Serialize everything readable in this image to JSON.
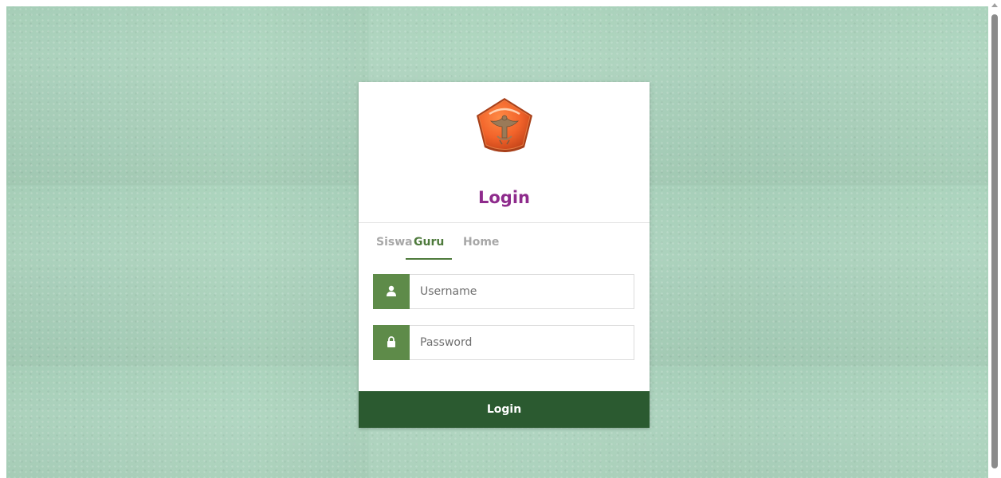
{
  "page": {
    "background_color": "#a9d2bb"
  },
  "login_card": {
    "logo_icon": "school-emblem-logo",
    "title": "Login",
    "title_color": "#8e2b8c",
    "tabs": [
      {
        "label": "Siswa",
        "active": false
      },
      {
        "label": "Guru",
        "active": true
      },
      {
        "label": "Home",
        "active": false
      }
    ],
    "tab_active_color": "#4e7a3c",
    "username": {
      "icon": "user-icon",
      "placeholder": "Username",
      "value": ""
    },
    "password": {
      "icon": "lock-icon",
      "placeholder": "Password",
      "value": ""
    },
    "addon_color": "#5e8b49",
    "submit_label": "Login",
    "submit_color": "#2b5a30"
  }
}
